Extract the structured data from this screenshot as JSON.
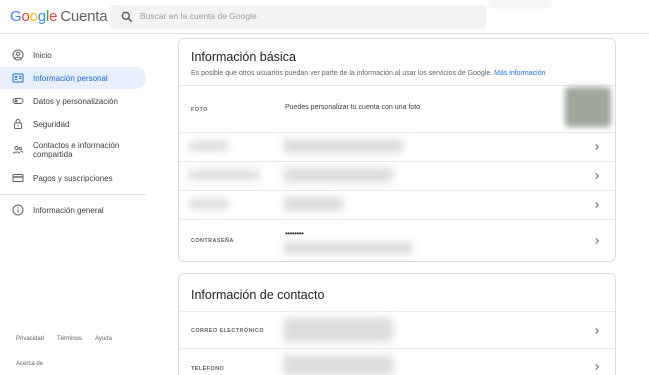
{
  "header": {
    "logo_google": [
      "G",
      "o",
      "o",
      "g",
      "l",
      "e"
    ],
    "product": "Cuenta",
    "search_placeholder": "Buscar en la cuenta de Google"
  },
  "sidebar": {
    "items": [
      {
        "label": "Inicio",
        "icon": "home-icon"
      },
      {
        "label": "Información personal",
        "icon": "id-card-icon",
        "active": true
      },
      {
        "label": "Datos y personalización",
        "icon": "toggle-icon"
      },
      {
        "label": "Seguridad",
        "icon": "lock-icon"
      },
      {
        "label": "Contactos e información compartida",
        "icon": "people-icon"
      },
      {
        "label": "Pagos y suscripciones",
        "icon": "credit-card-icon"
      }
    ],
    "general": {
      "label": "Información general",
      "icon": "info-icon"
    },
    "footer": {
      "privacy": "Privacidad",
      "terms": "Términos",
      "help": "Ayuda",
      "about": "Acerca de"
    }
  },
  "basic_info": {
    "title": "Información básica",
    "description": "Es posible que otros usuarios puedan ver parte de la información al usar los servicios de Google.",
    "more_link": "Más información",
    "photo_label": "FOTO",
    "photo_text": "Puedes personalizar tu cuenta con una foto",
    "password_label": "CONTRASEÑA",
    "password_value": "••••••••"
  },
  "contact_info": {
    "title": "Información de contacto",
    "email_label": "CORREO ELECTRÓNICO",
    "phone_label": "TELÉFONO"
  },
  "colors": {
    "accent": "#1a73e8",
    "active_bg": "#e8f0fe",
    "border": "#dadce0"
  }
}
